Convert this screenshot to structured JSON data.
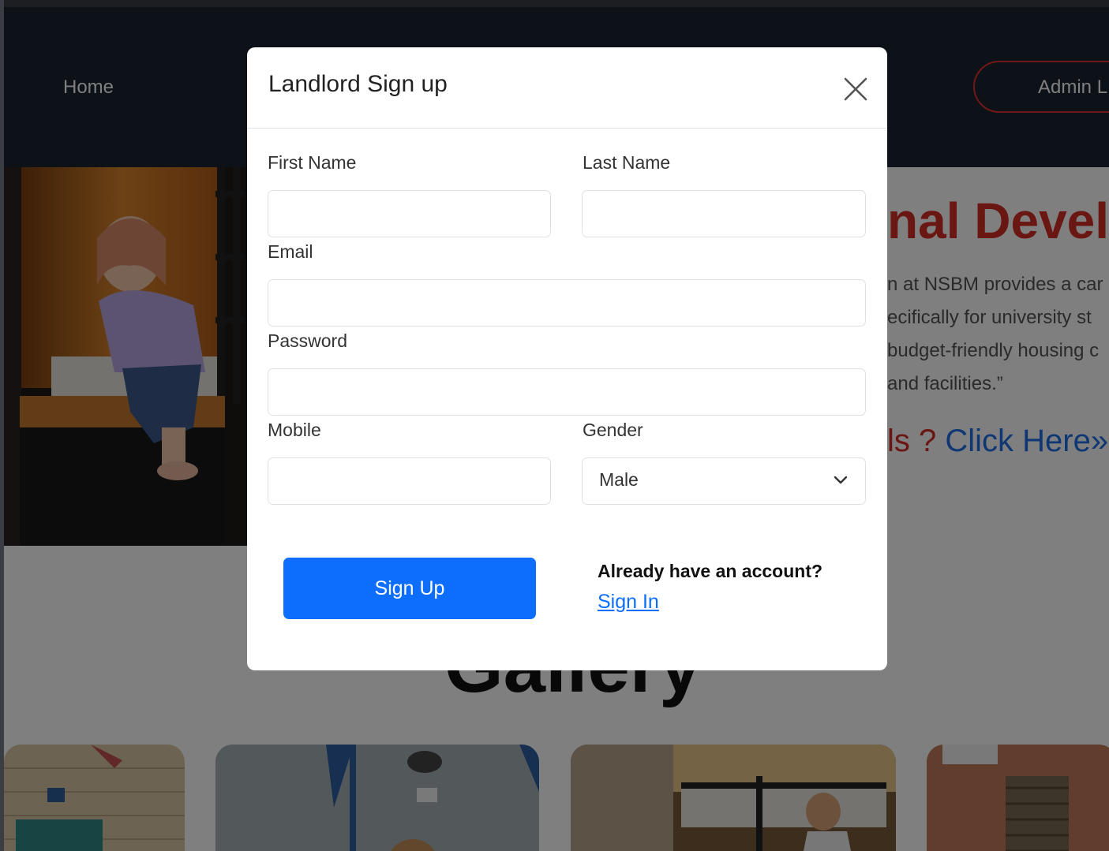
{
  "nav": {
    "home": "Home",
    "admin": "Admin L"
  },
  "hero": {
    "title": "nal Devel",
    "paragraph": [
      "n at NSBM provides a car",
      "ecifically for university st",
      "budget-friendly housing c",
      " and facilities.”"
    ],
    "link_prefix": "ls ? ",
    "link_text": "Click Here»"
  },
  "gallery": {
    "title": "Gallery"
  },
  "modal": {
    "title": "Landlord Sign up",
    "close_icon": "close-icon",
    "fields": {
      "first_name": {
        "label": "First Name",
        "value": "",
        "placeholder": ""
      },
      "last_name": {
        "label": "Last Name",
        "value": "",
        "placeholder": ""
      },
      "email": {
        "label": "Email",
        "value": "",
        "placeholder": ""
      },
      "password": {
        "label": "Password",
        "value": "",
        "placeholder": ""
      },
      "mobile": {
        "label": "Mobile",
        "value": "",
        "placeholder": ""
      },
      "gender": {
        "label": "Gender",
        "selected": "Male",
        "icon": "chevron-down-icon"
      }
    },
    "signup_button": "Sign Up",
    "have_account": "Already have an account?",
    "signin_link": "Sign In"
  },
  "colors": {
    "primary": "#0d6efd",
    "accent_red": "#d42d24",
    "navbar": "#1a2433"
  }
}
